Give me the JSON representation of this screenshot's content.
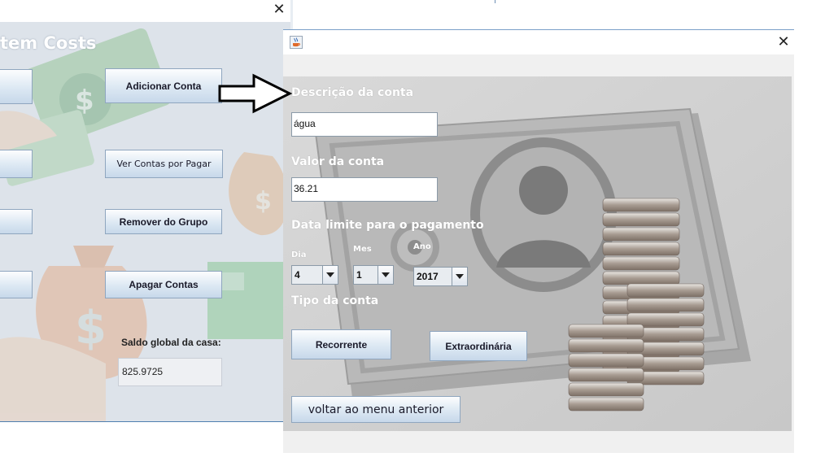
{
  "back_window": {
    "title": "tem Costs",
    "close_glyph": "✕",
    "buttons": {
      "adicionar_conta": "Adicionar Conta",
      "ver_contas": "Ver Contas por Pagar",
      "remover_grupo": "Remover do Grupo",
      "apagar_contas": "Apagar Contas"
    },
    "saldo_label": "Saldo global da casa:",
    "saldo_value": "825.9725"
  },
  "front_window": {
    "close_glyph": "✕",
    "icon": "java-cup-icon",
    "labels": {
      "descricao": "Descrição da conta",
      "valor": "Valor da conta",
      "data_limite": "Data limite para o pagamento",
      "dia": "Dia",
      "mes": "Mes",
      "ano": "Ano",
      "tipo": "Tipo da conta"
    },
    "fields": {
      "descricao_value": "água",
      "valor_value": "36.21"
    },
    "combos": {
      "dia": "4",
      "mes": "1",
      "ano": "2017"
    },
    "buttons": {
      "recorrente": "Recorrente",
      "extraordinaria": "Extraordinária",
      "voltar": "voltar ao menu anterior"
    }
  },
  "colors": {
    "window_border": "#7aa0c8",
    "button_gradient_top": "#fcfdfe",
    "button_gradient_bottom": "#c7d8ea",
    "label_text": "#ffffff"
  }
}
